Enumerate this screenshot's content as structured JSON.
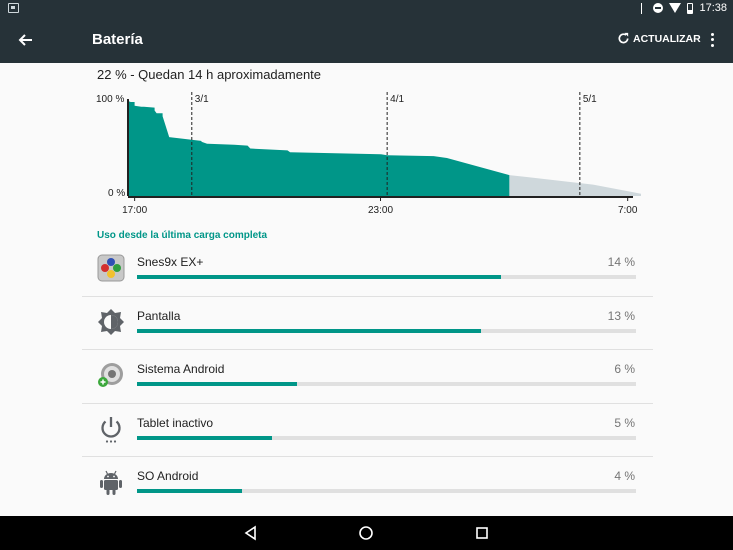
{
  "status_bar": {
    "time": "17:38",
    "icons": [
      "bluetooth-icon",
      "do-not-disturb-icon",
      "wifi-icon",
      "battery-icon"
    ]
  },
  "app_bar": {
    "title": "Batería",
    "refresh_label": "ACTUALIZAR"
  },
  "summary": "22 % - Quedan 14 h aproximadamente",
  "chart_data": {
    "type": "area",
    "y_labels": [
      "100 %",
      "0 %"
    ],
    "x_labels": [
      "17:00",
      "23:00",
      "7:00"
    ],
    "day_markers": [
      "3/1",
      "4/1",
      "5/1"
    ],
    "ylim": [
      0,
      100
    ],
    "series": [
      {
        "x": [
          0,
          0.2,
          0.5,
          0.5,
          1.0,
          1.2,
          2.0,
          2.0,
          2.15,
          2.6,
          2.6,
          3.1,
          5.5,
          5.55,
          5.95,
          6.0,
          8.0,
          9.0,
          9.2,
          12.0,
          12.2,
          19.0,
          19.5,
          23.0,
          24.0,
          28.7
        ],
        "y": [
          100,
          99,
          99,
          95,
          94,
          94,
          93,
          90,
          87,
          87,
          84,
          62,
          58,
          57,
          55,
          55,
          54,
          53,
          50,
          48,
          46,
          44,
          43,
          42,
          40,
          22
        ],
        "color": "#009688",
        "name": ""
      },
      {
        "x": [
          28.7,
          30.0,
          35.0,
          39.5
        ],
        "y": [
          22,
          20,
          12,
          0
        ],
        "color": "#cfd8dc",
        "name": ""
      }
    ],
    "grid": false
  },
  "section_title": "Uso desde la última carga completa",
  "usage": [
    {
      "name": "Snes9x EX+",
      "percent": "14 %",
      "fill": 0.73,
      "icon": "snes-controller-icon"
    },
    {
      "name": "Pantalla",
      "percent": "13 %",
      "fill": 0.69,
      "icon": "brightness-icon"
    },
    {
      "name": "Sistema Android",
      "percent": "6 %",
      "fill": 0.32,
      "icon": "android-system-icon"
    },
    {
      "name": "Tablet inactivo",
      "percent": "5 %",
      "fill": 0.27,
      "icon": "power-icon"
    },
    {
      "name": "SO Android",
      "percent": "4 %",
      "fill": 0.21,
      "icon": "android-robot-icon"
    }
  ]
}
